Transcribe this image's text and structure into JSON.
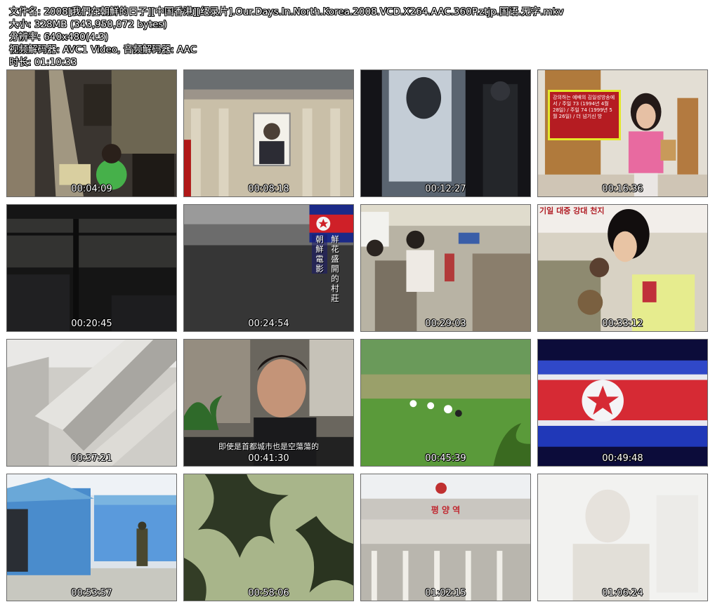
{
  "header": {
    "lines": [
      "文件名: 2008[我們在朝鮮的日子][中国香港][纪录片].Our.Days.In.North.Korea.2008.VCD.X264.AAC.360P.ztjp.国语.无字.mkv",
      "大小: 328MB (343,950,072 bytes)",
      "分辨率: 640x480(4:3)",
      "视频解码器: AVC1 Video, 音频解码器: AAC",
      "时长: 01:10:33"
    ]
  },
  "thumbnails": [
    {
      "time": "00:04:09"
    },
    {
      "time": "00:08:18"
    },
    {
      "time": "00:12:27"
    },
    {
      "time": "00:16:36",
      "sign_text": "강의하는 예배의 김일성방송에서 / 주일 73 (1994년 4월 28일) / 주일 74 (1999년 5월 26일) / 더 넘기신 방"
    },
    {
      "time": "00:20:45"
    },
    {
      "time": "00:24:54",
      "caption_a": "朝鮮電影",
      "caption_b": "鮮花盛開的村莊"
    },
    {
      "time": "00:29:03"
    },
    {
      "time": "00:33:12",
      "banner_text": "기일 대중 강대 천지"
    },
    {
      "time": "00:37:21"
    },
    {
      "time": "00:41:30",
      "subtitle": "即使是首都城市也是空蕩蕩的"
    },
    {
      "time": "00:45:39"
    },
    {
      "time": "00:49:48"
    },
    {
      "time": "00:53:57"
    },
    {
      "time": "00:58:06"
    },
    {
      "time": "01:02:15",
      "station_sign": "평 양 역"
    },
    {
      "time": "01:06:24"
    }
  ]
}
